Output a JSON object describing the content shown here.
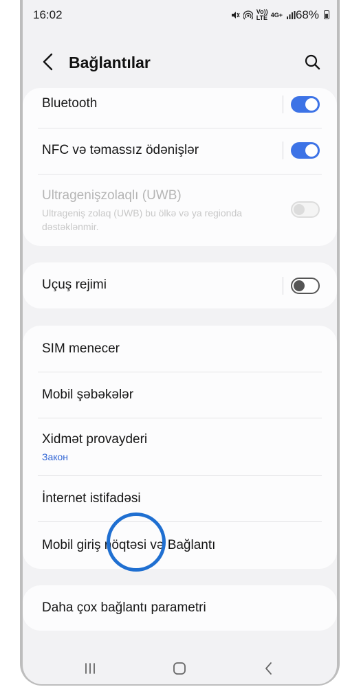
{
  "status_bar": {
    "time": "16:02",
    "volte_label": "Vo)) LTE",
    "network_label": "4G+",
    "battery_percent": "68%"
  },
  "header": {
    "title": "Bağlantılar"
  },
  "sections": {
    "group1": {
      "bluetooth": {
        "label": "Bluetooth",
        "on": true
      },
      "nfc": {
        "label": "NFC və təmassız ödənişlər",
        "on": true
      },
      "uwb": {
        "label": "Ultragenişzolaqlı (UWB)",
        "sub": "Ultrageniş zolaq (UWB) bu ölkə və ya regionda dəstəklənmir.",
        "on": false
      }
    },
    "group2": {
      "airplane": {
        "label": "Uçuş rejimi",
        "on": false
      }
    },
    "group3": {
      "sim_manager": {
        "label": "SIM menecer"
      },
      "mobile_networks": {
        "label": "Mobil şəbəkələr"
      },
      "service_provider": {
        "label": "Xidmət provayderi",
        "sub": "Закон"
      },
      "data_usage": {
        "label": "İnternet istifadəsi"
      },
      "hotspot": {
        "label": "Mobil giriş nöqtəsi və Bağlantı"
      }
    },
    "group4": {
      "more": {
        "label": "Daha çox bağlantı parametri"
      }
    }
  },
  "colors": {
    "accent": "#3d73e6",
    "touch_indicator": "#1f6fd1",
    "background": "#f2f2f4",
    "card": "#fcfcfd"
  },
  "icons": {
    "back": "back-arrow-icon",
    "search": "search-icon",
    "nav_recents": "recents-icon",
    "nav_home": "home-icon",
    "nav_back": "nav-back-icon"
  }
}
